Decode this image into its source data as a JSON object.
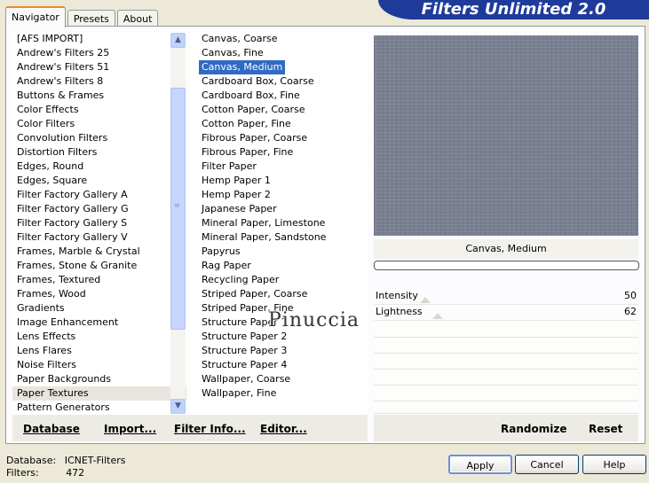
{
  "tabs": [
    {
      "label": "Navigator",
      "active": true
    },
    {
      "label": "Presets",
      "active": false
    },
    {
      "label": "About",
      "active": false
    }
  ],
  "banner": {
    "title": "Filters Unlimited 2.0"
  },
  "categories": {
    "items": [
      "[AFS IMPORT]",
      "Andrew's Filters 25",
      "Andrew's Filters 51",
      "Andrew's Filters 8",
      "Buttons & Frames",
      "Color Effects",
      "Color Filters",
      "Convolution Filters",
      "Distortion Filters",
      "Edges, Round",
      "Edges, Square",
      "Filter Factory Gallery A",
      "Filter Factory Gallery G",
      "Filter Factory Gallery S",
      "Filter Factory Gallery V",
      "Frames, Marble & Crystal",
      "Frames, Stone & Granite",
      "Frames, Textured",
      "Frames, Wood",
      "Gradients",
      "Image Enhancement",
      "Lens Effects",
      "Lens Flares",
      "Noise Filters",
      "Paper Backgrounds",
      "Paper Textures",
      "Pattern Generators"
    ],
    "highlighted": "Paper Textures"
  },
  "filters": {
    "items": [
      "Canvas, Coarse",
      "Canvas, Fine",
      "Canvas, Medium",
      "Cardboard Box, Coarse",
      "Cardboard Box, Fine",
      "Cotton Paper, Coarse",
      "Cotton Paper, Fine",
      "Fibrous Paper, Coarse",
      "Fibrous Paper, Fine",
      "Filter Paper",
      "Hemp Paper 1",
      "Hemp Paper 2",
      "Japanese Paper",
      "Mineral Paper, Limestone",
      "Mineral Paper, Sandstone",
      "Papyrus",
      "Rag Paper",
      "Recycling Paper",
      "Striped Paper, Coarse",
      "Striped Paper, Fine",
      "Structure Paper 1",
      "Structure Paper 2",
      "Structure Paper 3",
      "Structure Paper 4",
      "Wallpaper, Coarse",
      "Wallpaper, Fine"
    ],
    "selected": "Canvas, Medium"
  },
  "toolbar": {
    "database": "Database",
    "import": "Import...",
    "filter_info": "Filter Info...",
    "editor": "Editor...",
    "randomize": "Randomize",
    "reset": "Reset"
  },
  "preview": {
    "label": "Canvas, Medium",
    "color": "#7a8092"
  },
  "sliders": [
    {
      "label": "Intensity",
      "value": "50"
    },
    {
      "label": "Lightness",
      "value": "62"
    }
  ],
  "status": {
    "database_label": "Database:",
    "database_value": "ICNET-Filters",
    "filters_label": "Filters:",
    "filters_value": "472"
  },
  "buttons": {
    "apply": "Apply",
    "cancel": "Cancel",
    "help": "Help"
  },
  "watermark": "Pinuccia"
}
